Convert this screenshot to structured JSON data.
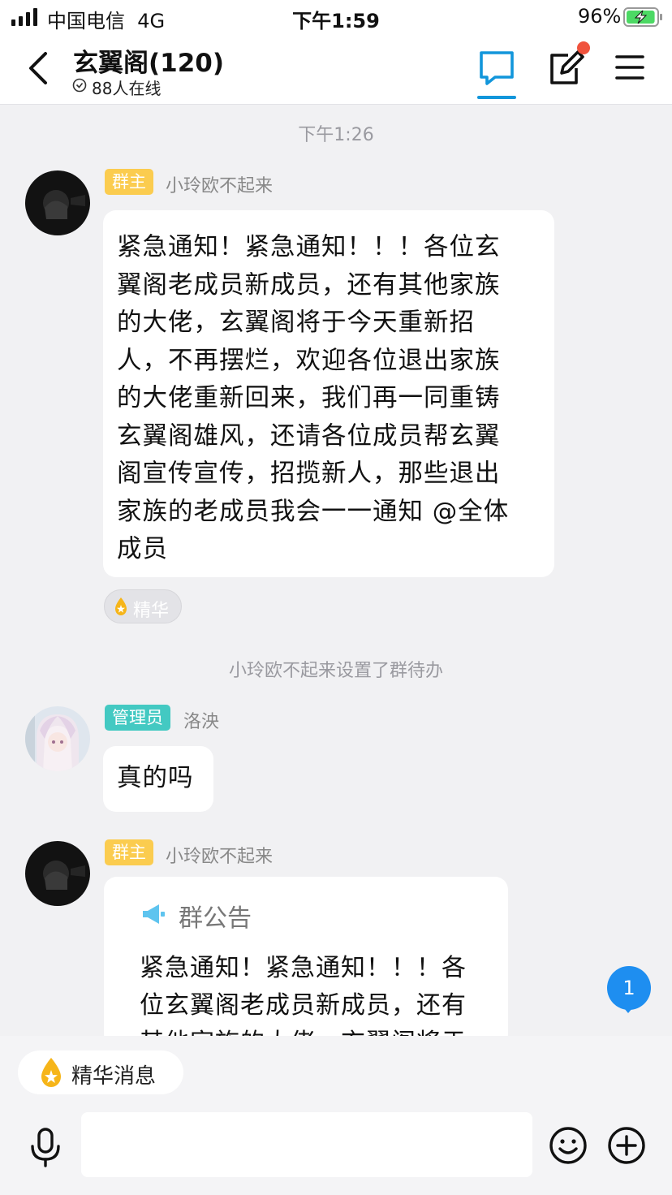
{
  "status_bar": {
    "carrier": "中国电信",
    "network": "4G",
    "time": "下午1:59",
    "battery_percent": "96%",
    "battery_level": 0.96,
    "battery_color": "#4cd964"
  },
  "header": {
    "title": "玄翼阁(120)",
    "online_count": "88人在线",
    "icons": [
      "back-arrow-icon",
      "chat-bubble-icon",
      "edit-icon",
      "menu-icon"
    ],
    "accent_color": "#1296db",
    "notification_dot_color": "#f0533d"
  },
  "chat": {
    "timestamp": "下午1:26",
    "messages": [
      {
        "role_badge": "群主",
        "sender": "小玲欧不起来",
        "lines": [
          "紧急通知！紧急通知！！！各位玄",
          "翼阁老成员新成员，还有其他家族",
          "的大佬，玄翼阁将于今天重新招",
          "人，不再摆烂，欢迎各位退出家族",
          "的大佬重新回来，我们再一同重铸",
          "玄翼阁雄风，还请各位成员帮玄翼",
          "阁宣传宣传，招揽新人，那些退出",
          "家族的老成员我会一一通知 @全体",
          "成员"
        ],
        "tag": "精华"
      },
      {
        "role_badge": "管理员",
        "sender": "洛泱",
        "text": "真的吗"
      },
      {
        "role_badge": "群主",
        "sender": "小玲欧不起来",
        "notice_title": "群公告",
        "notice_lines": [
          "紧急通知！紧急通知！！！各",
          "位玄翼阁老成员新成员，还有",
          "其他家族的大佬，玄翼阁将于"
        ]
      }
    ],
    "system_message": "小玲欧不起来设置了群待办",
    "unread_count": "1"
  },
  "bottom": {
    "essence_label": "精华消息",
    "icons": [
      "microphone-icon",
      "emoji-icon",
      "plus-icon"
    ]
  }
}
